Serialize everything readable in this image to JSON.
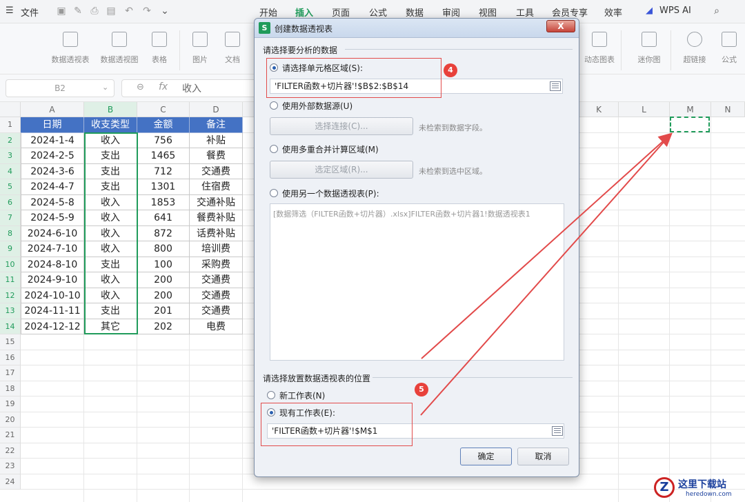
{
  "menubar": {
    "file_label": "文件",
    "tabs": [
      "开始",
      "插入",
      "页面",
      "公式",
      "数据",
      "审阅",
      "视图",
      "工具",
      "会员专享",
      "效率"
    ],
    "active_tab": "插入",
    "wps_ai": "WPS AI"
  },
  "ribbon": {
    "items": [
      "数据透视表",
      "数据透视图",
      "表格",
      "图片",
      "文档",
      "动态图表",
      "迷你图",
      "超链接",
      "公式"
    ]
  },
  "formula_bar": {
    "name_box": "B2",
    "fx": "fx",
    "content": "收入"
  },
  "sheet": {
    "columns_left": [
      "A",
      "B",
      "C",
      "D"
    ],
    "columns_right": [
      "K",
      "L",
      "M",
      "N"
    ],
    "rows": [
      "1",
      "2",
      "3",
      "4",
      "5",
      "6",
      "7",
      "8",
      "9",
      "10",
      "11",
      "12",
      "13",
      "14",
      "15",
      "16",
      "17",
      "18",
      "19",
      "20",
      "21",
      "22",
      "23",
      "24"
    ],
    "header": [
      "日期",
      "收支类型",
      "金额",
      "备注"
    ],
    "data": [
      [
        "2024-1-4",
        "收入",
        "756",
        "补贴"
      ],
      [
        "2024-2-5",
        "支出",
        "1465",
        "餐费"
      ],
      [
        "2024-3-6",
        "支出",
        "712",
        "交通费"
      ],
      [
        "2024-4-7",
        "支出",
        "1301",
        "住宿费"
      ],
      [
        "2024-5-8",
        "收入",
        "1853",
        "交通补贴"
      ],
      [
        "2024-5-9",
        "收入",
        "641",
        "餐费补贴"
      ],
      [
        "2024-6-10",
        "收入",
        "872",
        "话费补贴"
      ],
      [
        "2024-7-10",
        "收入",
        "800",
        "培训费"
      ],
      [
        "2024-8-10",
        "支出",
        "100",
        "采购费"
      ],
      [
        "2024-9-10",
        "收入",
        "200",
        "交通费"
      ],
      [
        "2024-10-10",
        "收入",
        "200",
        "交通费"
      ],
      [
        "2024-11-11",
        "支出",
        "201",
        "交通费"
      ],
      [
        "2024-12-12",
        "其它",
        "202",
        "电费"
      ]
    ]
  },
  "dialog": {
    "logo": "S",
    "title": "创建数据透视表",
    "close": "X",
    "section1": "请选择要分析的数据",
    "opt_range": "请选择单元格区域(S):",
    "range_value": "'FILTER函数+切片器'!$B$2:$B$14",
    "opt_external": "使用外部数据源(U)",
    "btn_select_conn": "选择连接(C)...",
    "note_no_fields": "未检索到数据字段。",
    "opt_consolidate": "使用多重合并计算区域(M)",
    "btn_select_region": "选定区域(R)...",
    "note_no_region": "未检索到选中区域。",
    "opt_another": "使用另一个数据透视表(P):",
    "pivot_list_item": "[数据筛选（FILTER函数+切片器）.xlsx]FILTER函数+切片器1!数据透视表1",
    "section2": "请选择放置数据透视表的位置",
    "opt_new_sheet": "新工作表(N)",
    "opt_existing": "现有工作表(E):",
    "existing_value": "'FILTER函数+切片器'!$M$1",
    "ok": "确定",
    "cancel": "取消"
  },
  "annotations": {
    "badge4": "4",
    "badge5": "5",
    "accent_red": "#e24a4a"
  },
  "watermark": {
    "site": "这里下载站",
    "url": "heredown.com"
  }
}
